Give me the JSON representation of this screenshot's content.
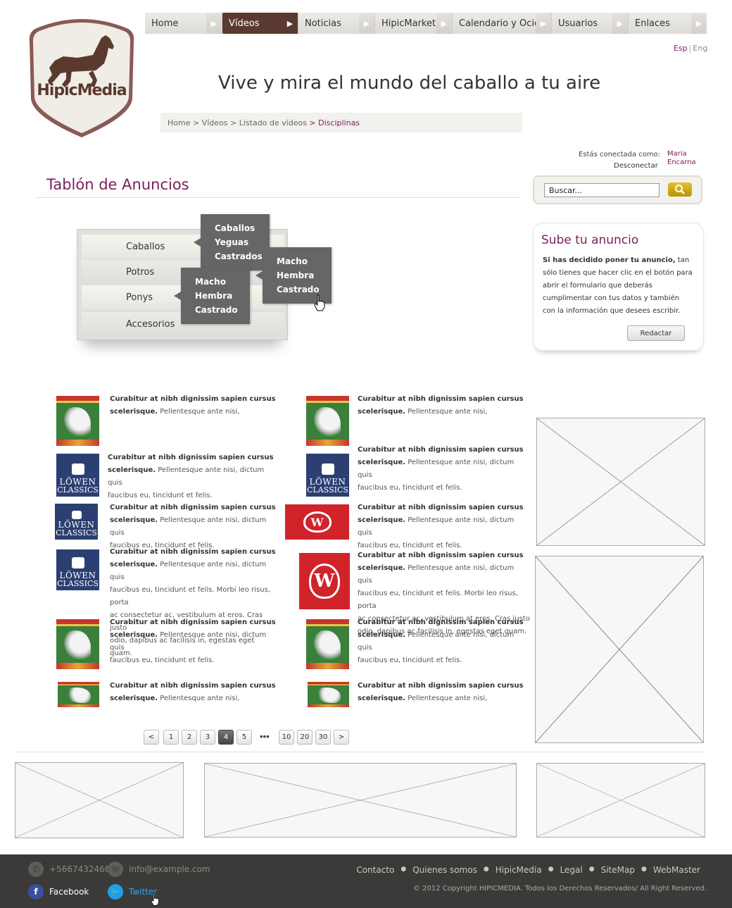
{
  "logo": {
    "brand": "HipicMedia"
  },
  "nav": {
    "items": [
      {
        "label": "Home"
      },
      {
        "label": "Vídeos",
        "active": true
      },
      {
        "label": "Noticias"
      },
      {
        "label": "HipicMarket"
      },
      {
        "label": "Calendario y Ocio"
      },
      {
        "label": "Usuarios"
      },
      {
        "label": "Enlaces"
      }
    ]
  },
  "lang": {
    "esp": "Esp",
    "eng": "Eng"
  },
  "tagline": "Vive y mira el mundo del caballo a tu aire",
  "breadcrumb": {
    "home": "Home",
    "videos": "Vídeos",
    "listado": "Listado de vídeos",
    "current": "Disciplinas",
    "sep": ">"
  },
  "login": {
    "label": "Estás conectada como:",
    "user": "Maria Encarna",
    "logout": "Desconectar"
  },
  "section_title": "Tablón de Anuncios",
  "search": {
    "placeholder": "Buscar..."
  },
  "sube": {
    "title": "Sube tu anuncio",
    "bold": "Si has decidido poner tu anuncio,",
    "text": " tan sólo tienes que hacer clic en el botón para abrir el formulario que deberás cumplimentar con tus datos y también con la información que desees escribir.",
    "button": "Redactar"
  },
  "categories": {
    "items": [
      "Caballos",
      "Potros",
      "Ponys",
      "Accesorios"
    ],
    "popup_caballos": [
      "Caballos",
      "Yeguas",
      "Castrados"
    ],
    "popup_potros": [
      "Macho",
      "Hembra",
      "Castrado"
    ],
    "popup_ponys": [
      "Macho",
      "Hembra",
      "Castrado"
    ]
  },
  "listings": {
    "title": "Curabitur at nibh dignissim sapien cursus",
    "bold2": "scelerisque.",
    "short": " Pellentesque ante nisi,",
    "medium_a": " Pellentesque ante nisi, dictum quis",
    "medium_b": "faucibus eu, tincidunt et felis.",
    "long_b": "faucibus eu, tincidunt et felis. Morbi leo risus, porta",
    "long_c": "ac consectetur ac, vestibulum at eros. Cras justo",
    "long_d": "odio, dapibus ac facilisis in, egestas eget quam.",
    "lowen_1": "LÖWEN",
    "lowen_2": "CLASSICS",
    "w": "W"
  },
  "pagination": {
    "prev": "<",
    "next": ">",
    "pages": [
      "1",
      "2",
      "3",
      "4",
      "5"
    ],
    "dots": "•••",
    "pages2": [
      "10",
      "20",
      "30"
    ],
    "active": "4"
  },
  "footer": {
    "phone": "+5667432466",
    "email": "info@example.com",
    "facebook": "Facebook",
    "twitter": "Twitter",
    "links": [
      "Contacto",
      "Quienes somos",
      "HipicMedia",
      "Legal",
      "SiteMap",
      "WebMaster"
    ],
    "copyright": "© 2012 Copyright HIPICMEDIA. Todos los Derechos Reservados/ All Right Reserved."
  },
  "colors": {
    "accent": "#7a1e5c",
    "nav_active": "#5a3a30",
    "footer_bg": "#3b3a38",
    "search_btn": "#d4ae18"
  }
}
